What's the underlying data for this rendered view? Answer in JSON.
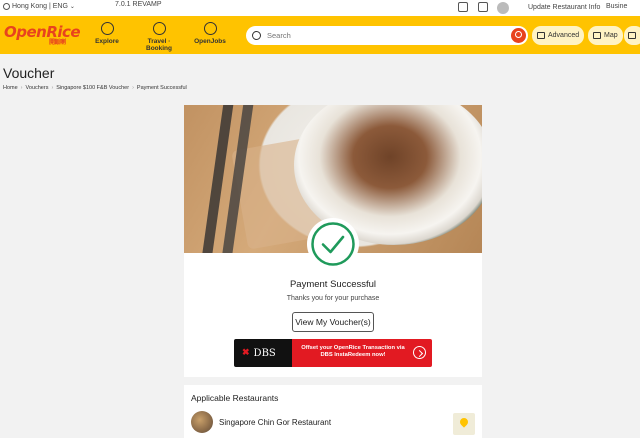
{
  "topbar": {
    "region": "Hong Kong | ENG",
    "version": "7.0.1 REVAMP",
    "update_restaurant": "Update Restaurant Info",
    "business": "Busine"
  },
  "header": {
    "logo": "OpenRice",
    "logo_sub": "開飯喇",
    "nav": [
      {
        "label": "Explore"
      },
      {
        "label": "Travel · Booking"
      },
      {
        "label": "OpenJobs"
      }
    ],
    "search_placeholder": "Search",
    "advanced_label": "Advanced",
    "map_label": "Map"
  },
  "page": {
    "title": "Voucher",
    "breadcrumb": [
      "Home",
      "Vouchers",
      "Singapore $100 F&B Voucher",
      "Payment Successful"
    ]
  },
  "payment": {
    "title": "Payment Successful",
    "subtitle": "Thanks you for your purchase",
    "view_button": "View My Voucher(s)",
    "check_color": "#1f9a5b"
  },
  "dbs_banner": {
    "brand": "DBS",
    "text_line1": "Offset your OpenRice Transaction via",
    "text_line2": "DBS InstaRedeem now!",
    "color": "#e21a22"
  },
  "applicable": {
    "title": "Applicable Restaurants",
    "restaurants": [
      {
        "name": "Singapore Chin Gor Restaurant"
      }
    ]
  },
  "colors": {
    "brand_yellow": "#ffc300",
    "brand_red": "#e8431e"
  }
}
